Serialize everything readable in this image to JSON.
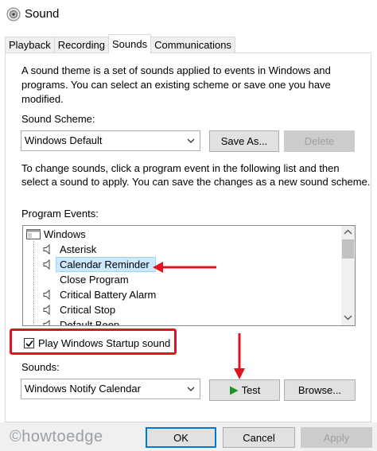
{
  "window": {
    "title": "Sound"
  },
  "tabs": [
    {
      "label": "Playback"
    },
    {
      "label": "Recording"
    },
    {
      "label": "Sounds",
      "selected": true
    },
    {
      "label": "Communications"
    }
  ],
  "intro_text": {
    "line1": "A sound theme is a set of sounds applied to events in Windows and",
    "line2": "programs.  You can select an existing scheme or save one you have",
    "line3": "modified."
  },
  "sound_scheme": {
    "label": "Sound Scheme:",
    "value": "Windows Default",
    "save_as_label": "Save As...",
    "delete_label": "Delete"
  },
  "change_text": {
    "line1": "To change sounds, click a program event in the following list and then",
    "line2": "select a sound to apply.  You can save the changes as a new sound scheme."
  },
  "program_events": {
    "label": "Program Events:",
    "items": [
      {
        "label": "Windows",
        "type": "group"
      },
      {
        "label": "Asterisk",
        "type": "sound"
      },
      {
        "label": "Calendar Reminder",
        "type": "sound",
        "selected": true
      },
      {
        "label": "Close Program",
        "type": "none"
      },
      {
        "label": "Critical Battery Alarm",
        "type": "sound"
      },
      {
        "label": "Critical Stop",
        "type": "sound"
      },
      {
        "label": "Default Beep",
        "type": "sound"
      }
    ]
  },
  "startup": {
    "label": "Play Windows Startup sound",
    "checked": true
  },
  "sounds": {
    "label": "Sounds:",
    "value": "Windows Notify Calendar",
    "test_label": "Test",
    "browse_label": "Browse..."
  },
  "footer": {
    "ok_label": "OK",
    "cancel_label": "Cancel",
    "apply_label": "Apply",
    "watermark": "©howtoedge"
  },
  "colors": {
    "annotation_red": "#e0141e",
    "selection_blue": "#cce8ff",
    "default_button_border": "#0078d7",
    "play_green": "#1f8f2b"
  }
}
